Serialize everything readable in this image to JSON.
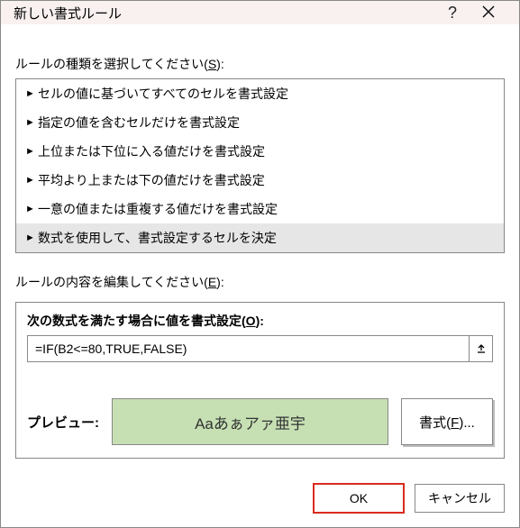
{
  "titlebar": {
    "title": "新しい書式ルール",
    "help": "?",
    "close": "×"
  },
  "ruleTypeLabel": {
    "pre": "ルールの種類を選択してください(",
    "accel": "S",
    "post": "):"
  },
  "ruleTypes": [
    "セルの値に基づいてすべてのセルを書式設定",
    "指定の値を含むセルだけを書式設定",
    "上位または下位に入る値だけを書式設定",
    "平均より上または下の値だけを書式設定",
    "一意の値または重複する値だけを書式設定",
    "数式を使用して、書式設定するセルを決定"
  ],
  "ruleEditLabel": {
    "pre": "ルールの内容を編集してください(",
    "accel": "E",
    "post": "):"
  },
  "formulaLabel": {
    "pre": "次の数式を満たす場合に値を書式設定(",
    "accel": "O",
    "post": "):"
  },
  "formula": "=IF(B2<=80,TRUE,FALSE)",
  "preview": {
    "label": "プレビュー:",
    "sample": "Aaあぁアァ亜宇"
  },
  "formatBtn": {
    "pre": "書式(",
    "accel": "F",
    "post": ")..."
  },
  "buttons": {
    "ok": "OK",
    "cancel": "キャンセル"
  }
}
